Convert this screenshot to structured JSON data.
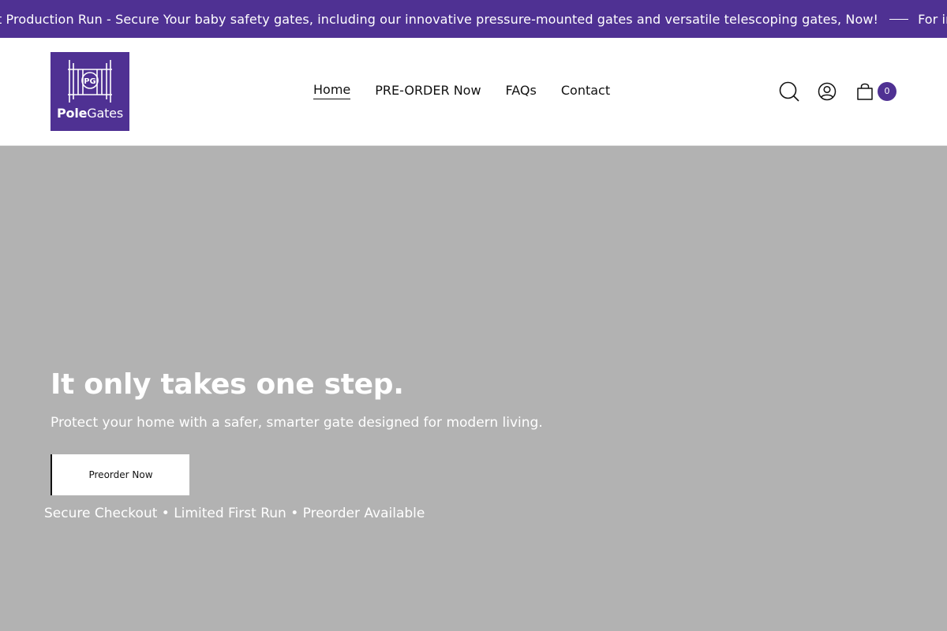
{
  "announcement": {
    "text_1": "t Production Run - Secure Your baby safety gates, including our innovative pressure-mounted gates and versatile telescoping gates, Now!",
    "text_2": "For inqu"
  },
  "brand": {
    "logo_text_bold": "Pole",
    "logo_text_regular": "Gates",
    "logo_monogram": "PG",
    "accent_color": "#4f3193"
  },
  "nav": {
    "items": [
      {
        "label": "Home",
        "active": true
      },
      {
        "label": "PRE-ORDER Now",
        "active": false
      },
      {
        "label": "FAQs",
        "active": false
      },
      {
        "label": "Contact",
        "active": false
      }
    ]
  },
  "header_icons": {
    "search": "search-icon",
    "account": "account-icon",
    "cart": "cart-icon",
    "cart_count": "0"
  },
  "hero": {
    "title": "It only takes one step.",
    "subtitle": "Protect your home with a safer, smarter gate designed for modern living.",
    "cta_label": "Preorder Now",
    "trust_line": "Secure Checkout • Limited First Run • Preorder Available",
    "background_color": "#b2b2b2"
  }
}
